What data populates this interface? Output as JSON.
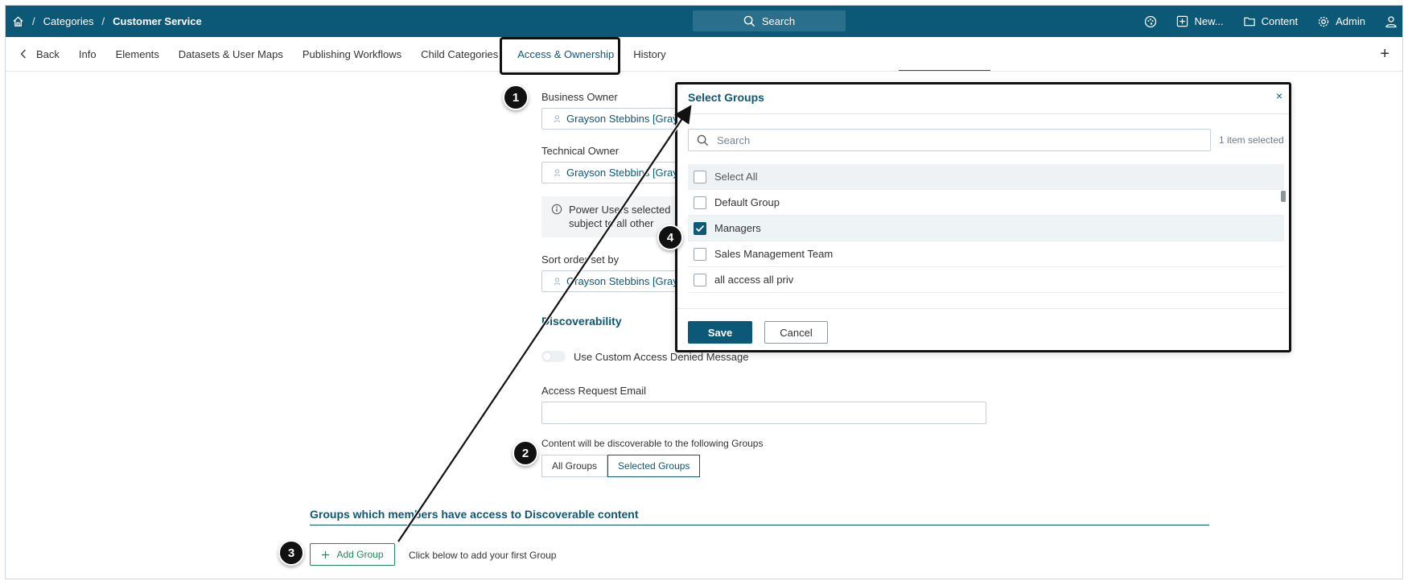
{
  "topbar": {
    "crumbs": [
      "Categories",
      "Customer Service"
    ],
    "crumb_sep": "/",
    "search_label": "Search",
    "new_label": "New...",
    "content_label": "Content",
    "admin_label": "Admin"
  },
  "tabs": {
    "back_label": "Back",
    "items": [
      "Info",
      "Elements",
      "Datasets & User Maps",
      "Publishing Workflows",
      "Child Categories",
      "Access & Ownership",
      "History"
    ],
    "active": "Access & Ownership",
    "plus_label": "+"
  },
  "form": {
    "business_owner_label": "Business Owner",
    "business_owner_value": "Grayson Stebbins [Grayson]",
    "technical_owner_label": "Technical Owner",
    "technical_owner_value": "Grayson Stebbins [Grayson]",
    "info_line1": "Power Users selected",
    "info_line2": "subject to all other",
    "sort_order_label": "Sort order set by",
    "sort_order_value": "Grayson Stebbins [Grayson]",
    "discoverability_title": "Discoverability",
    "custom_message_label": "Use Custom Access Denied Message",
    "access_request_email_label": "Access Request Email",
    "discoverable_label": "Content will be discoverable to the following Groups",
    "segment": [
      "All Groups",
      "Selected Groups"
    ],
    "segment_selected": "Selected Groups",
    "groups_title": "Groups which members have access to Discoverable content",
    "add_group_label": "Add Group",
    "add_group_hint": "Click below to add your first Group"
  },
  "modal": {
    "title": "Select Groups",
    "close_label": "×",
    "search_placeholder": "Search",
    "selected_count": "1 item selected",
    "select_all_label": "Select All",
    "groups": [
      {
        "label": "Default Group",
        "checked": false
      },
      {
        "label": "Managers",
        "checked": true
      },
      {
        "label": "Sales Management Team",
        "checked": false
      },
      {
        "label": "all access all priv",
        "checked": false
      }
    ],
    "save_label": "Save",
    "cancel_label": "Cancel"
  },
  "annotations": [
    "1",
    "2",
    "3",
    "4"
  ],
  "colors": {
    "brand": "#0c5877",
    "accent_green": "#1f8a59",
    "annotation": "#111111"
  }
}
